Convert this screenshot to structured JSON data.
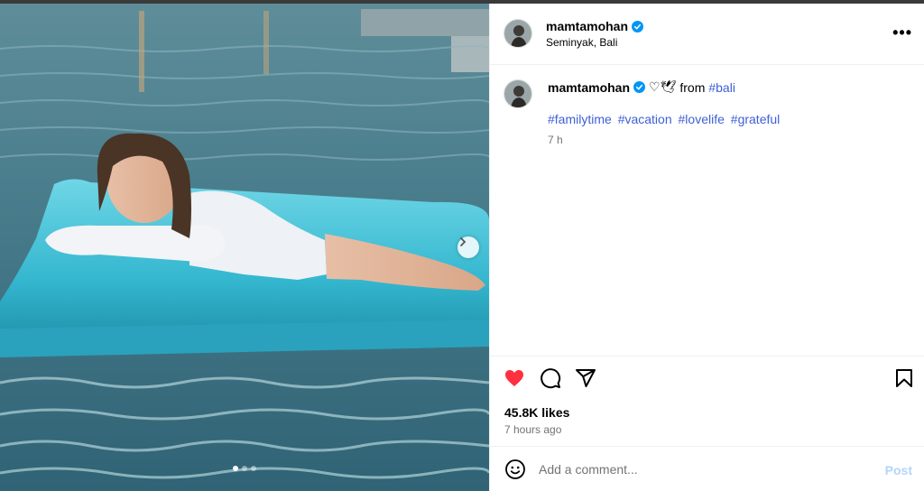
{
  "post": {
    "username": "mamtamohan",
    "location": "Seminyak, Bali",
    "caption": {
      "username": "mamtamohan",
      "emojis": "♡🕊",
      "from_text": "from",
      "location_tag": "#bali",
      "hashtags": [
        "#familytime",
        "#vacation",
        "#lovelife",
        "#grateful"
      ],
      "time": "7 h"
    },
    "likes": "45.8K likes",
    "timestamp": "7 hours ago",
    "carousel": {
      "current": 1,
      "total": 3
    }
  },
  "comment": {
    "placeholder": "Add a comment...",
    "post_label": "Post"
  },
  "colors": {
    "heart": "#ff3040",
    "hashtag": "#3f5fd6",
    "verified": "#0095f6",
    "post_disabled": "#b3d4fc"
  },
  "icons": {
    "more": "more-options-icon",
    "like": "heart-filled-icon",
    "comment": "comment-icon",
    "share": "share-icon",
    "save": "bookmark-icon",
    "emoji": "emoji-icon",
    "next": "chevron-right-icon"
  },
  "more_label": "•••"
}
